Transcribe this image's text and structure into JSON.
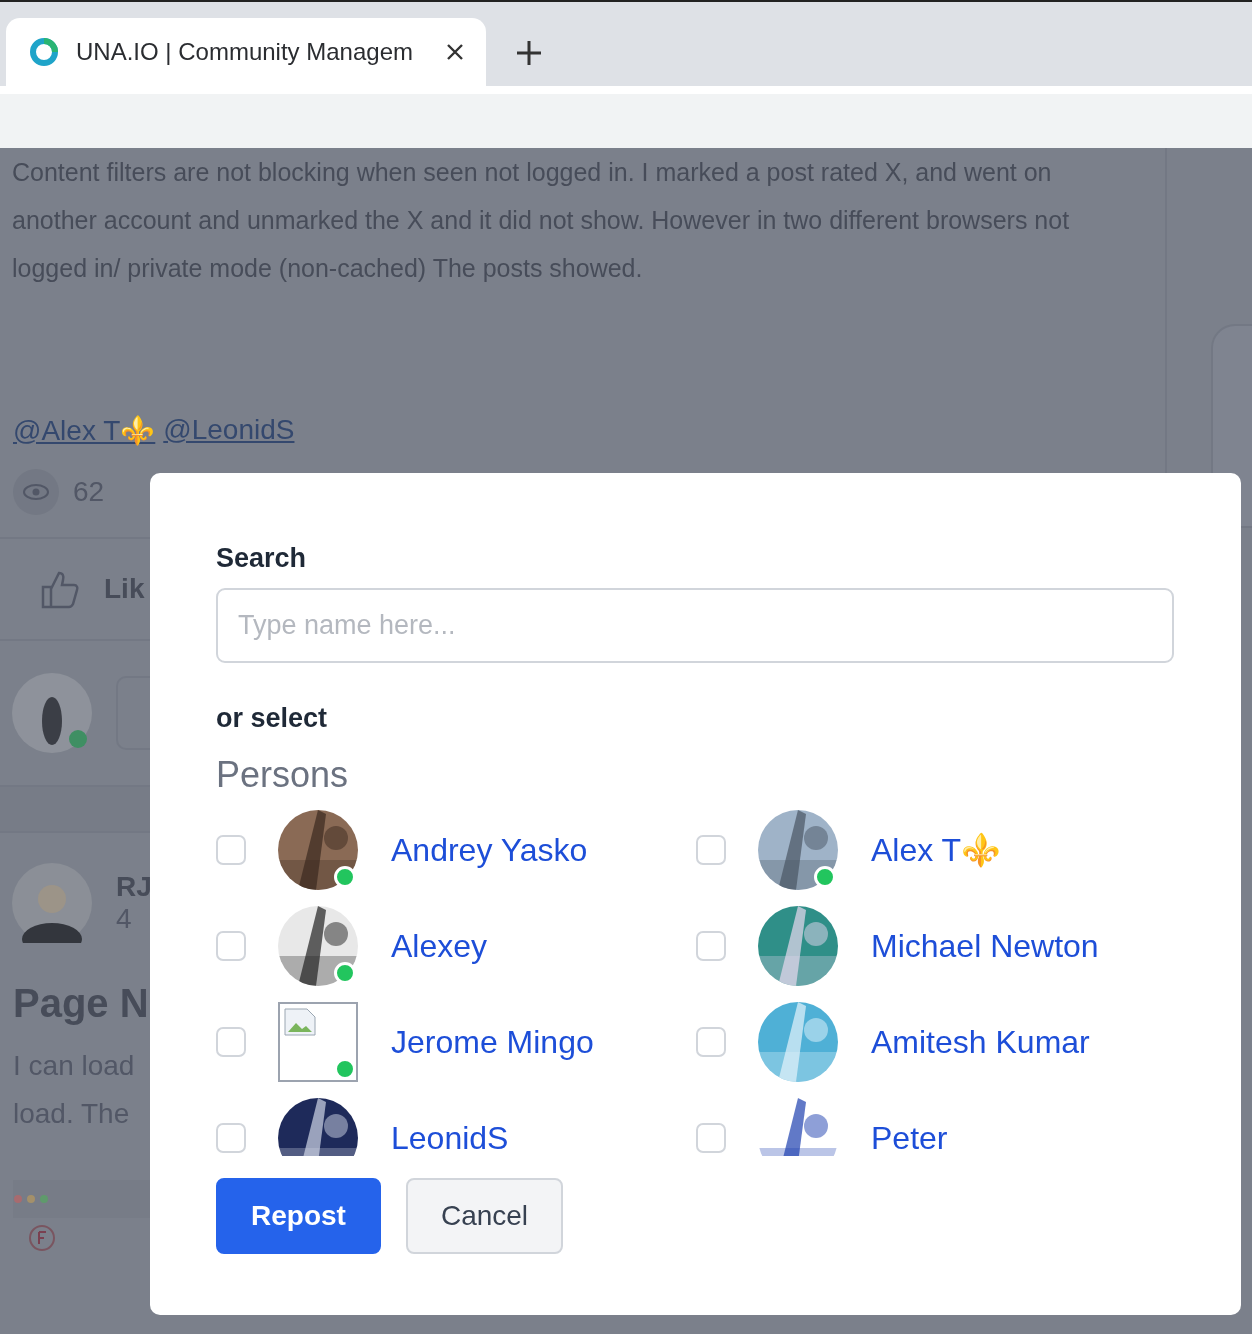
{
  "browser": {
    "tab_title": "UNA.IO | Community Managem"
  },
  "background": {
    "post_text": "Content filters are not blocking when seen not logged in. I marked a post rated X, and went on another account and unmarked the X and it did not show. However in two different browsers not logged in/ private mode (non-cached) The posts showed.",
    "mentions": [
      "@Alex T⚜️",
      "@LeonidS"
    ],
    "views": "62",
    "like_label": "Lik",
    "author": "RJ",
    "time": "4",
    "post_title": "Page N",
    "body_lines": [
      "I can load",
      "load. The"
    ]
  },
  "dialog": {
    "search_label": "Search",
    "search_placeholder": "Type name here...",
    "or_select": "or select",
    "section": "Persons",
    "persons": [
      {
        "name": "Andrey Yasko",
        "checked": false,
        "online": true,
        "kind": "picture"
      },
      {
        "name": "Alex T⚜️",
        "checked": false,
        "online": true,
        "kind": "picture"
      },
      {
        "name": "Alexey",
        "checked": false,
        "online": true,
        "kind": "picture"
      },
      {
        "name": "Michael Newton",
        "checked": false,
        "online": false,
        "kind": "picture"
      },
      {
        "name": "Jerome Mingo",
        "checked": false,
        "online": true,
        "kind": "broken"
      },
      {
        "name": "Amitesh Kumar",
        "checked": false,
        "online": false,
        "kind": "picture"
      },
      {
        "name": "LeonidS",
        "checked": false,
        "online": false,
        "kind": "picture"
      },
      {
        "name": "Peter",
        "checked": false,
        "online": false,
        "kind": "picture"
      }
    ],
    "buttons": [
      {
        "label": "Repost",
        "kind": "primary"
      },
      {
        "label": "Cancel",
        "kind": "secondary"
      }
    ]
  }
}
